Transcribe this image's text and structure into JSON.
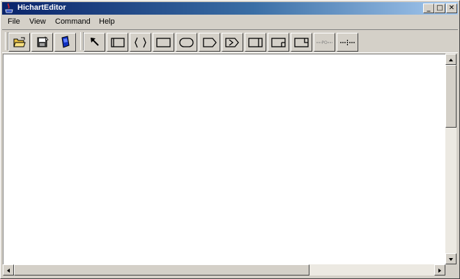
{
  "window": {
    "title": "HichartEditor"
  },
  "title_buttons": [
    {
      "name": "minimize-button",
      "glyph": "_"
    },
    {
      "name": "maximize-button",
      "glyph": "□"
    },
    {
      "name": "close-button",
      "glyph": "✕"
    }
  ],
  "menu": [
    "File",
    "View",
    "Command",
    "Help"
  ],
  "toolbar": {
    "file_tools": [
      "open-folder-icon",
      "save-disk-icon",
      "book-icon"
    ],
    "draw_tools": [
      "pointer-arrow-icon",
      "process-box-icon",
      "brace-pair-icon",
      "rectangle-icon",
      "rounded-rect-icon",
      "pentagon-tag-icon",
      "arrow-tag-icon",
      "rect-bar-right-icon",
      "rect-bar-corner-icon",
      "rect-bar-top-icon",
      "dashed-line-po-icon",
      "dashed-line-tee-icon"
    ],
    "po_label": "PO"
  },
  "colors": {
    "title_start": "#0a246a",
    "title_end": "#a6caf0",
    "face": "#d4d0c8",
    "canvas": "#ffffff"
  }
}
